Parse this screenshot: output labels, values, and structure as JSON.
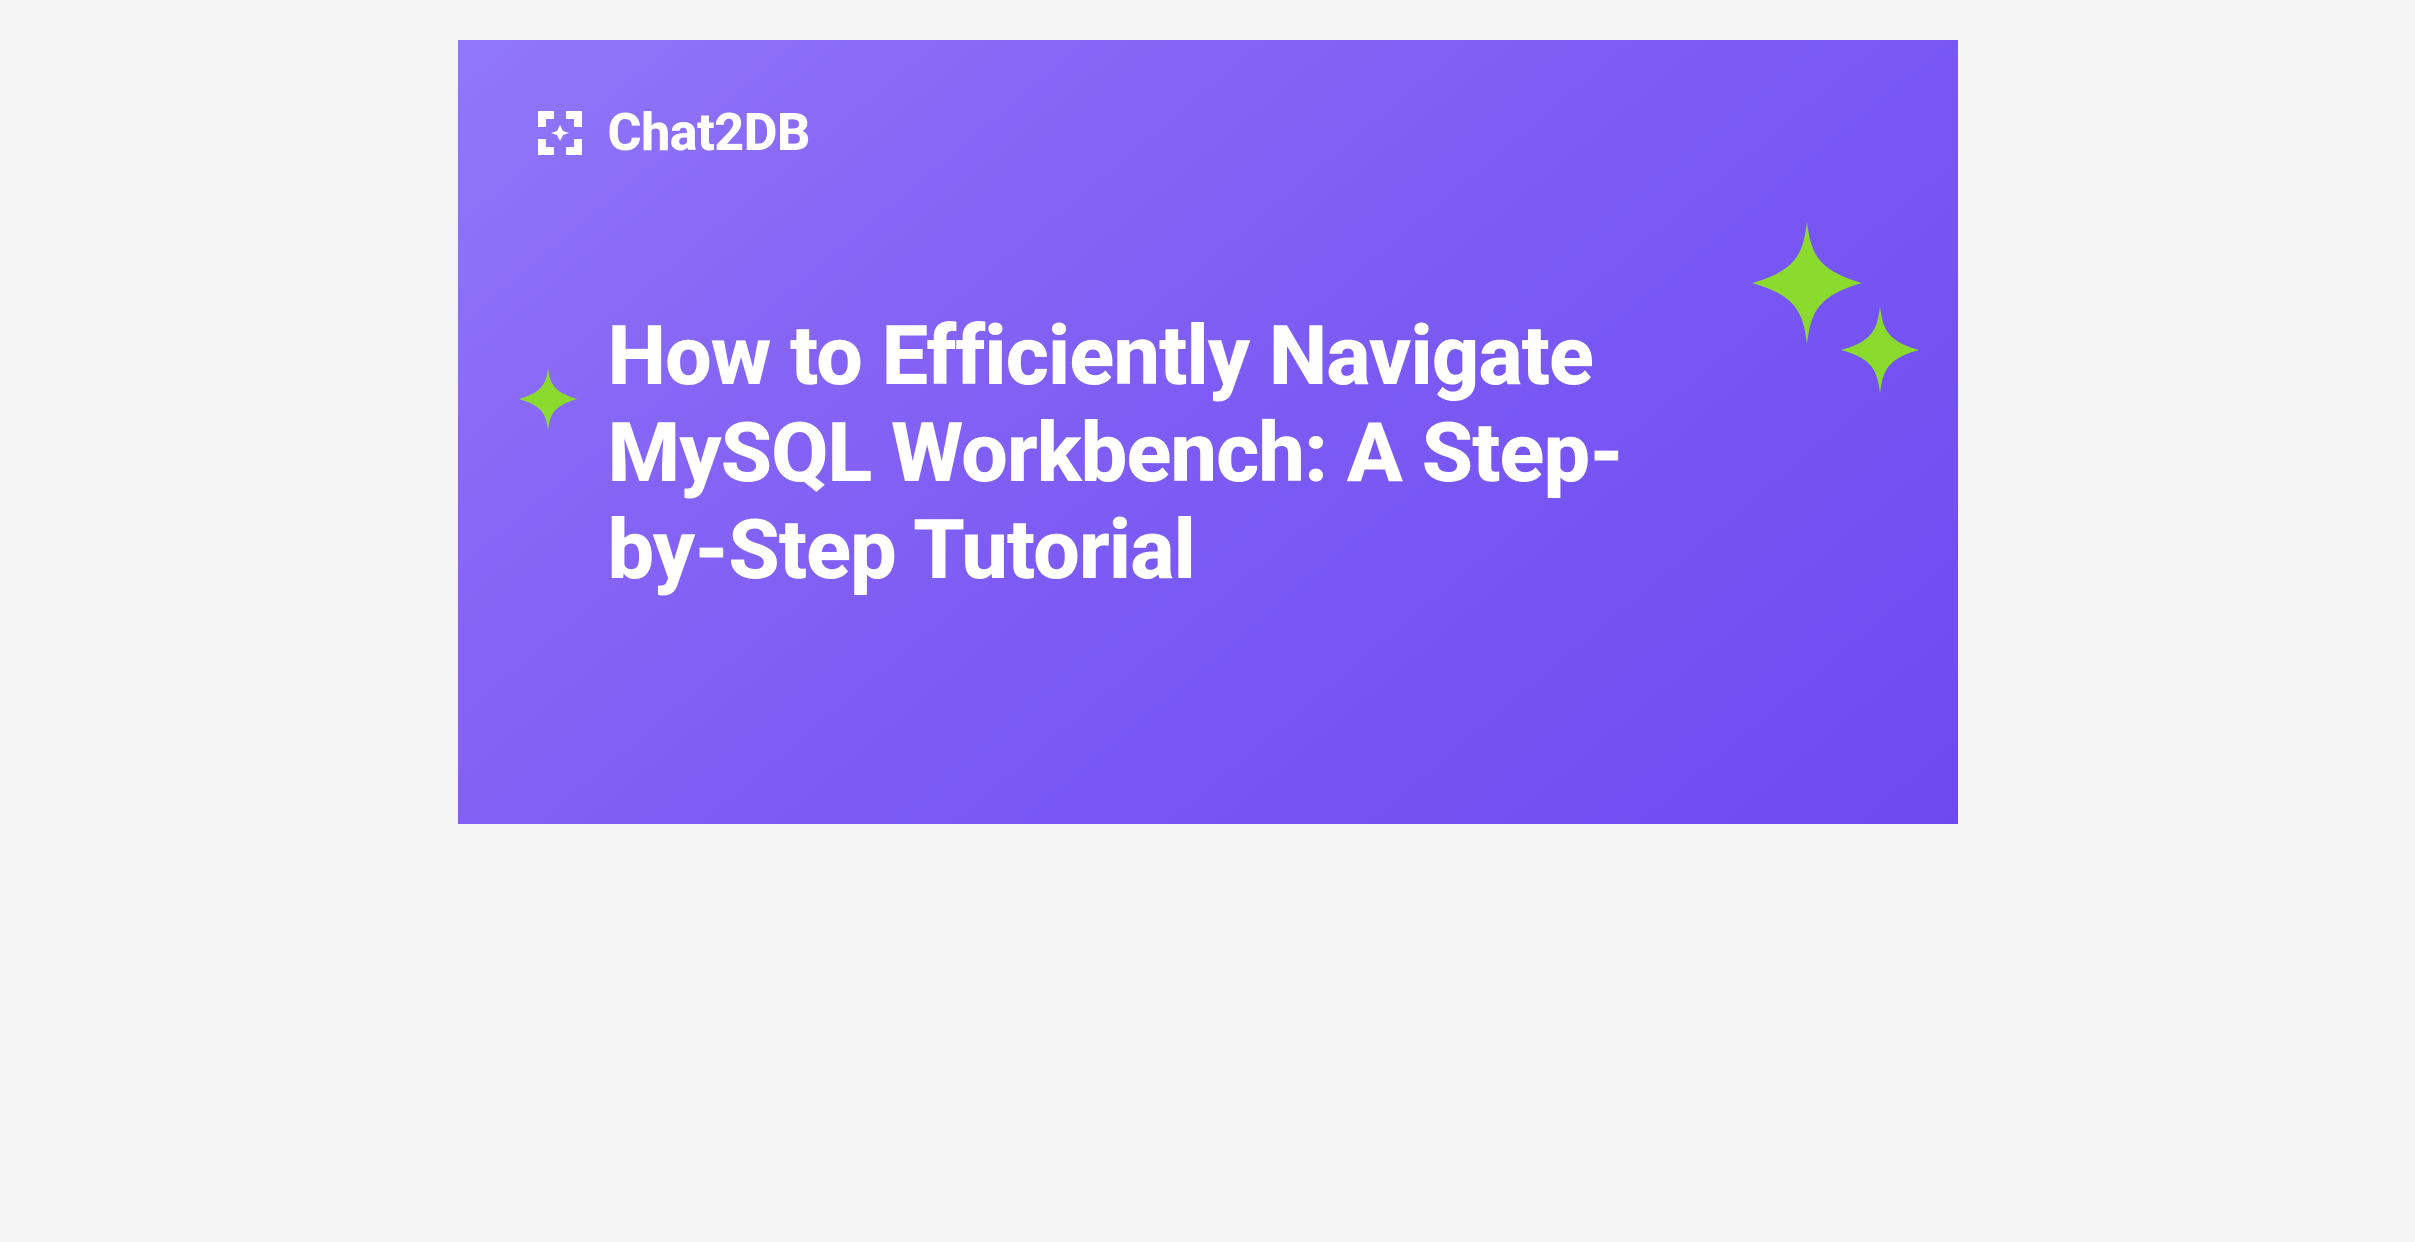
{
  "brand": {
    "name": "Chat2DB"
  },
  "heading": {
    "title": "How to Efficiently Navigate MySQL Workbench: A Step-by-Step Tutorial"
  },
  "colors": {
    "sparkle": "#8BDB2F",
    "text": "#ffffff"
  }
}
